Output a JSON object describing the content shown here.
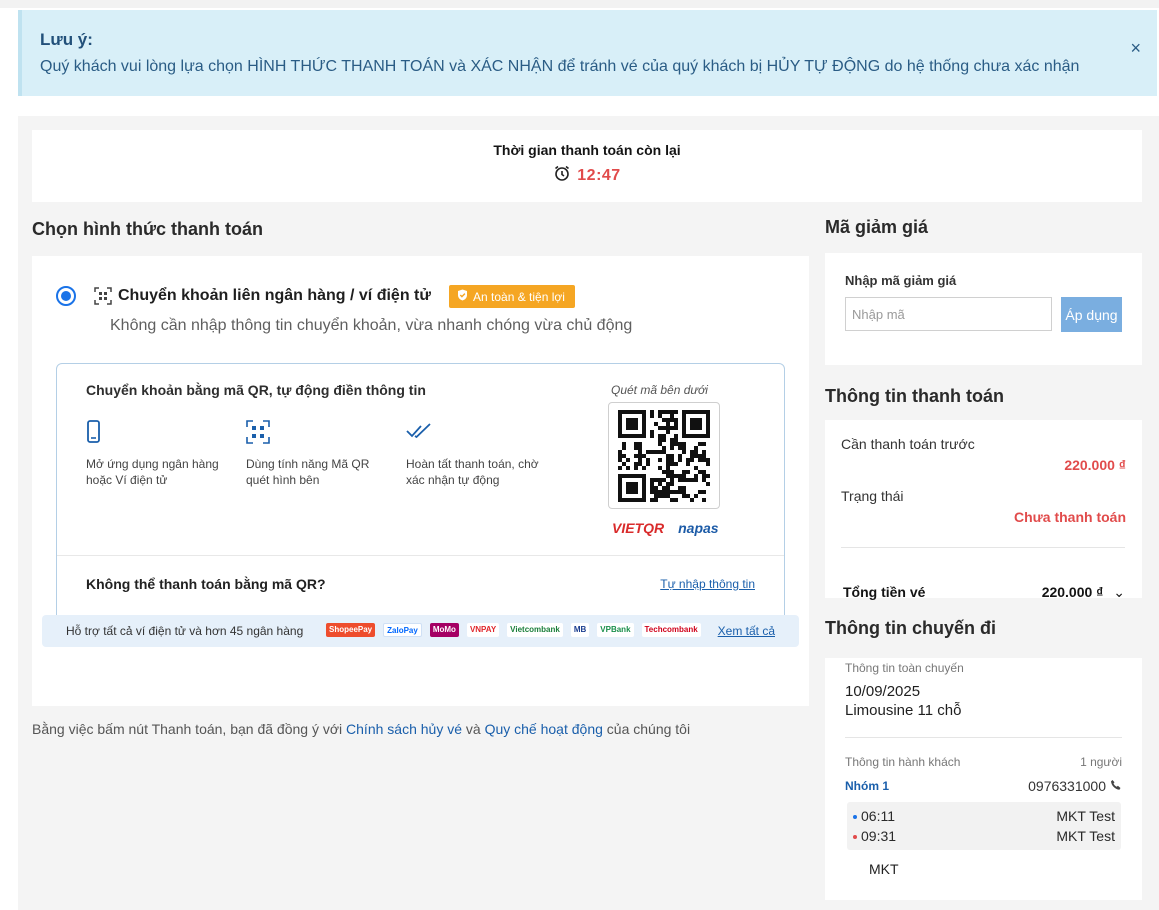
{
  "notice": {
    "title": "Lưu ý:",
    "text": "Quý khách vui lòng lựa chọn HÌNH THỨC THANH TOÁN và XÁC NHẬN để tránh vé của quý khách bị HỦY TỰ ĐỘNG do hệ thống chưa xác nhận",
    "close": "×"
  },
  "timer": {
    "label": "Thời gian thanh toán còn lại",
    "value": "12:47"
  },
  "payment": {
    "section_title": "Chọn hình thức thanh toán",
    "method_title": "Chuyển khoản liên ngân hàng / ví điện tử",
    "badge": "An toàn & tiện lợi",
    "method_subtitle": "Không cần nhập thông tin chuyển khoản, vừa nhanh chóng vừa chủ động",
    "qr": {
      "heading": "Chuyển khoản bằng mã QR, tự động điền thông tin",
      "steps": [
        {
          "text": "Mở ứng dụng ngân hàng hoặc Ví điện tử",
          "icon": "phone-icon"
        },
        {
          "text": "Dùng tính năng Mã QR quét hình bên",
          "icon": "qr-scan-icon"
        },
        {
          "text": "Hoàn tất thanh toán, chờ xác nhận tự động",
          "icon": "double-check-icon"
        }
      ],
      "scan_label": "Quét mã bên dưới",
      "brand_vietqr": "VIETQR",
      "brand_napas": "napas",
      "no_qr_question": "Không thể thanh toán bằng mã QR?",
      "manual_link": "Tự nhập thông tin"
    },
    "banks": {
      "text": "Hỗ trợ tất cả ví điện tử và hơn 45 ngân hàng",
      "logos": [
        "ShopeePay",
        "ZaloPay",
        "MoMo",
        "VNPAY",
        "Vietcombank",
        "MB",
        "VPBank",
        "Techcombank"
      ],
      "see_all": "Xem tất cả"
    }
  },
  "agreement": {
    "prefix": "Bằng việc bấm nút Thanh toán, bạn đã đồng ý với",
    "link1": "Chính sách hủy vé",
    "and": "và",
    "link2": "Quy chế hoạt động",
    "suffix": "của chúng tôi"
  },
  "discount": {
    "section_title": "Mã giảm giá",
    "label": "Nhập mã giảm giá",
    "placeholder": "Nhập mã",
    "apply": "Áp dụng"
  },
  "payment_info": {
    "section_title": "Thông tin thanh toán",
    "prepay_label": "Cần thanh toán trước",
    "prepay_value": "220.000 ₫",
    "status_label": "Trạng thái",
    "status_value": "Chưa thanh toán",
    "total_label": "Tổng tiền vé",
    "total_value": "220.000 ₫",
    "chevron": "⌄"
  },
  "trip": {
    "section_title": "Thông tin chuyến đi",
    "overview_label": "Thông tin toàn chuyến",
    "date": "10/09/2025",
    "vehicle": "Limousine 11 chỗ",
    "passenger_label": "Thông tin hành khách",
    "passenger_count": "1 người",
    "group": "Nhóm 1",
    "phone": "0976331000",
    "segments": [
      {
        "time": "06:11",
        "name": "MKT Test",
        "dot_color": "#1a73e8"
      },
      {
        "time": "09:31",
        "name": "MKT Test",
        "dot_color": "#e14b4b"
      }
    ],
    "operator": "MKT"
  },
  "colors": {
    "accent": "#1a73e8",
    "price_red": "#e14b4b",
    "badge_orange": "#f5a623",
    "notice_bg": "#d8eff8",
    "apply_button": "#7aaee0"
  }
}
